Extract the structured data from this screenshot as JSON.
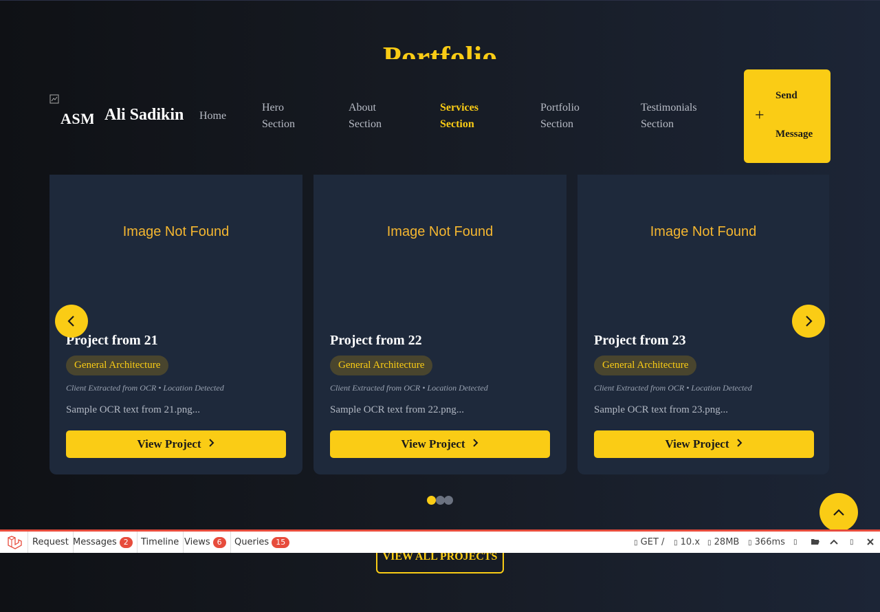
{
  "section_title": "Portfolio",
  "logo": {
    "alt_text": "ASM",
    "broken_icon": "broken-image-icon"
  },
  "brand": "Ali Sadikin",
  "nav": [
    {
      "line1": "Home",
      "line2": ""
    },
    {
      "line1": "Hero",
      "line2": "Section"
    },
    {
      "line1": "About",
      "line2": "Section"
    },
    {
      "line1": "Services",
      "line2": "Section"
    },
    {
      "line1": "Portfolio",
      "line2": "Section"
    },
    {
      "line1": "Testimonials",
      "line2": "Section"
    }
  ],
  "send_message": {
    "line1": "Send",
    "line2": "Message",
    "icon": "plus-icon"
  },
  "cards": [
    {
      "image_fallback": "Image Not Found",
      "title": "Project from 21",
      "tag": "General Architecture",
      "meta": "Client Extracted from OCR • Location Detected",
      "desc": "Sample OCR text from 21.png...",
      "button": "View Project"
    },
    {
      "image_fallback": "Image Not Found",
      "title": "Project from 22",
      "tag": "General Architecture",
      "meta": "Client Extracted from OCR • Location Detected",
      "desc": "Sample OCR text from 22.png...",
      "button": "View Project"
    },
    {
      "image_fallback": "Image Not Found",
      "title": "Project from 23",
      "tag": "General Architecture",
      "meta": "Client Extracted from OCR • Location Detected",
      "desc": "Sample OCR text from 23.png...",
      "button": "View Project"
    }
  ],
  "view_all": "VIEW ALL PROJECTS",
  "colors": {
    "accent": "#facc15",
    "card_bg": "#1e293b",
    "debug_red": "#e74c3c"
  },
  "debugbar": {
    "tabs": [
      {
        "label": "Request",
        "badge": ""
      },
      {
        "label": "Messages",
        "badge": "2"
      },
      {
        "label": "Timeline",
        "badge": ""
      },
      {
        "label": "Views",
        "badge": "6"
      },
      {
        "label": "Queries",
        "badge": "15"
      }
    ],
    "method": "GET /",
    "version": "10.x",
    "memory": "28MB",
    "time": "366ms"
  }
}
